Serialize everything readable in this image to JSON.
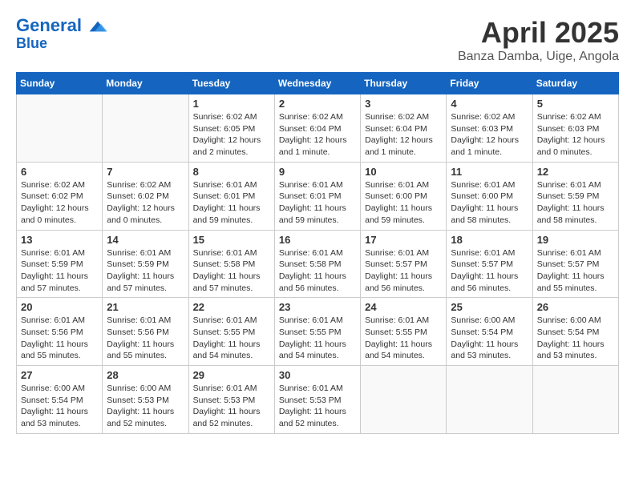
{
  "header": {
    "logo_line1": "General",
    "logo_line2": "Blue",
    "month": "April 2025",
    "location": "Banza Damba, Uige, Angola"
  },
  "weekdays": [
    "Sunday",
    "Monday",
    "Tuesday",
    "Wednesday",
    "Thursday",
    "Friday",
    "Saturday"
  ],
  "weeks": [
    [
      {
        "num": "",
        "detail": ""
      },
      {
        "num": "",
        "detail": ""
      },
      {
        "num": "1",
        "detail": "Sunrise: 6:02 AM\nSunset: 6:05 PM\nDaylight: 12 hours and 2 minutes."
      },
      {
        "num": "2",
        "detail": "Sunrise: 6:02 AM\nSunset: 6:04 PM\nDaylight: 12 hours and 1 minute."
      },
      {
        "num": "3",
        "detail": "Sunrise: 6:02 AM\nSunset: 6:04 PM\nDaylight: 12 hours and 1 minute."
      },
      {
        "num": "4",
        "detail": "Sunrise: 6:02 AM\nSunset: 6:03 PM\nDaylight: 12 hours and 1 minute."
      },
      {
        "num": "5",
        "detail": "Sunrise: 6:02 AM\nSunset: 6:03 PM\nDaylight: 12 hours and 0 minutes."
      }
    ],
    [
      {
        "num": "6",
        "detail": "Sunrise: 6:02 AM\nSunset: 6:02 PM\nDaylight: 12 hours and 0 minutes."
      },
      {
        "num": "7",
        "detail": "Sunrise: 6:02 AM\nSunset: 6:02 PM\nDaylight: 12 hours and 0 minutes."
      },
      {
        "num": "8",
        "detail": "Sunrise: 6:01 AM\nSunset: 6:01 PM\nDaylight: 11 hours and 59 minutes."
      },
      {
        "num": "9",
        "detail": "Sunrise: 6:01 AM\nSunset: 6:01 PM\nDaylight: 11 hours and 59 minutes."
      },
      {
        "num": "10",
        "detail": "Sunrise: 6:01 AM\nSunset: 6:00 PM\nDaylight: 11 hours and 59 minutes."
      },
      {
        "num": "11",
        "detail": "Sunrise: 6:01 AM\nSunset: 6:00 PM\nDaylight: 11 hours and 58 minutes."
      },
      {
        "num": "12",
        "detail": "Sunrise: 6:01 AM\nSunset: 5:59 PM\nDaylight: 11 hours and 58 minutes."
      }
    ],
    [
      {
        "num": "13",
        "detail": "Sunrise: 6:01 AM\nSunset: 5:59 PM\nDaylight: 11 hours and 57 minutes."
      },
      {
        "num": "14",
        "detail": "Sunrise: 6:01 AM\nSunset: 5:59 PM\nDaylight: 11 hours and 57 minutes."
      },
      {
        "num": "15",
        "detail": "Sunrise: 6:01 AM\nSunset: 5:58 PM\nDaylight: 11 hours and 57 minutes."
      },
      {
        "num": "16",
        "detail": "Sunrise: 6:01 AM\nSunset: 5:58 PM\nDaylight: 11 hours and 56 minutes."
      },
      {
        "num": "17",
        "detail": "Sunrise: 6:01 AM\nSunset: 5:57 PM\nDaylight: 11 hours and 56 minutes."
      },
      {
        "num": "18",
        "detail": "Sunrise: 6:01 AM\nSunset: 5:57 PM\nDaylight: 11 hours and 56 minutes."
      },
      {
        "num": "19",
        "detail": "Sunrise: 6:01 AM\nSunset: 5:57 PM\nDaylight: 11 hours and 55 minutes."
      }
    ],
    [
      {
        "num": "20",
        "detail": "Sunrise: 6:01 AM\nSunset: 5:56 PM\nDaylight: 11 hours and 55 minutes."
      },
      {
        "num": "21",
        "detail": "Sunrise: 6:01 AM\nSunset: 5:56 PM\nDaylight: 11 hours and 55 minutes."
      },
      {
        "num": "22",
        "detail": "Sunrise: 6:01 AM\nSunset: 5:55 PM\nDaylight: 11 hours and 54 minutes."
      },
      {
        "num": "23",
        "detail": "Sunrise: 6:01 AM\nSunset: 5:55 PM\nDaylight: 11 hours and 54 minutes."
      },
      {
        "num": "24",
        "detail": "Sunrise: 6:01 AM\nSunset: 5:55 PM\nDaylight: 11 hours and 54 minutes."
      },
      {
        "num": "25",
        "detail": "Sunrise: 6:00 AM\nSunset: 5:54 PM\nDaylight: 11 hours and 53 minutes."
      },
      {
        "num": "26",
        "detail": "Sunrise: 6:00 AM\nSunset: 5:54 PM\nDaylight: 11 hours and 53 minutes."
      }
    ],
    [
      {
        "num": "27",
        "detail": "Sunrise: 6:00 AM\nSunset: 5:54 PM\nDaylight: 11 hours and 53 minutes."
      },
      {
        "num": "28",
        "detail": "Sunrise: 6:00 AM\nSunset: 5:53 PM\nDaylight: 11 hours and 52 minutes."
      },
      {
        "num": "29",
        "detail": "Sunrise: 6:01 AM\nSunset: 5:53 PM\nDaylight: 11 hours and 52 minutes."
      },
      {
        "num": "30",
        "detail": "Sunrise: 6:01 AM\nSunset: 5:53 PM\nDaylight: 11 hours and 52 minutes."
      },
      {
        "num": "",
        "detail": ""
      },
      {
        "num": "",
        "detail": ""
      },
      {
        "num": "",
        "detail": ""
      }
    ]
  ]
}
